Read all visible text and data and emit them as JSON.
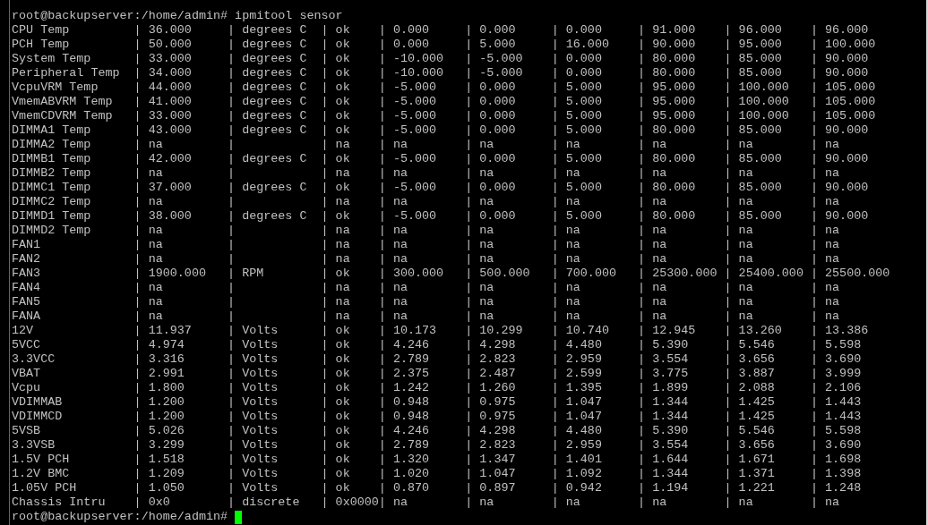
{
  "terminal": {
    "lines": [
      "root@backupserver:/home/admin# ipmitool sensor",
      "CPU Temp         | 36.000     | degrees C  | ok    | 0.000     | 0.000     | 0.000     | 91.000    | 96.000    | 96.000",
      "PCH Temp         | 50.000     | degrees C  | ok    | 0.000     | 5.000     | 16.000    | 90.000    | 95.000    | 100.000",
      "System Temp      | 33.000     | degrees C  | ok    | -10.000   | -5.000    | 0.000     | 80.000    | 85.000    | 90.000",
      "Peripheral Temp  | 34.000     | degrees C  | ok    | -10.000   | -5.000    | 0.000     | 80.000    | 85.000    | 90.000",
      "VcpuVRM Temp     | 44.000     | degrees C  | ok    | -5.000    | 0.000     | 5.000     | 95.000    | 100.000   | 105.000",
      "VmemABVRM Temp   | 41.000     | degrees C  | ok    | -5.000    | 0.000     | 5.000     | 95.000    | 100.000   | 105.000",
      "VmemCDVRM Temp   | 33.000     | degrees C  | ok    | -5.000    | 0.000     | 5.000     | 95.000    | 100.000   | 105.000",
      "DIMMA1 Temp      | 43.000     | degrees C  | ok    | -5.000    | 0.000     | 5.000     | 80.000    | 85.000    | 90.000",
      "DIMMA2 Temp      | na         |            | na    | na        | na        | na        | na        | na        | na",
      "DIMMB1 Temp      | 42.000     | degrees C  | ok    | -5.000    | 0.000     | 5.000     | 80.000    | 85.000    | 90.000",
      "DIMMB2 Temp      | na         |            | na    | na        | na        | na        | na        | na        | na",
      "DIMMC1 Temp      | 37.000     | degrees C  | ok    | -5.000    | 0.000     | 5.000     | 80.000    | 85.000    | 90.000",
      "DIMMC2 Temp      | na         |            | na    | na        | na        | na        | na        | na        | na",
      "DIMMD1 Temp      | 38.000     | degrees C  | ok    | -5.000    | 0.000     | 5.000     | 80.000    | 85.000    | 90.000",
      "DIMMD2 Temp      | na         |            | na    | na        | na        | na        | na        | na        | na",
      "FAN1             | na         |            | na    | na        | na        | na        | na        | na        | na",
      "FAN2             | na         |            | na    | na        | na        | na        | na        | na        | na",
      "FAN3             | 1900.000   | RPM        | ok    | 300.000   | 500.000   | 700.000   | 25300.000 | 25400.000 | 25500.000",
      "FAN4             | na         |            | na    | na        | na        | na        | na        | na        | na",
      "FAN5             | na         |            | na    | na        | na        | na        | na        | na        | na",
      "FANA             | na         |            | na    | na        | na        | na        | na        | na        | na",
      "12V              | 11.937     | Volts      | ok    | 10.173    | 10.299    | 10.740    | 12.945    | 13.260    | 13.386",
      "5VCC             | 4.974      | Volts      | ok    | 4.246     | 4.298     | 4.480     | 5.390     | 5.546     | 5.598",
      "3.3VCC           | 3.316      | Volts      | ok    | 2.789     | 2.823     | 2.959     | 3.554     | 3.656     | 3.690",
      "VBAT             | 2.991      | Volts      | ok    | 2.375     | 2.487     | 2.599     | 3.775     | 3.887     | 3.999",
      "Vcpu             | 1.800      | Volts      | ok    | 1.242     | 1.260     | 1.395     | 1.899     | 2.088     | 2.106",
      "VDIMMAB          | 1.200      | Volts      | ok    | 0.948     | 0.975     | 1.047     | 1.344     | 1.425     | 1.443",
      "VDIMMCD          | 1.200      | Volts      | ok    | 0.948     | 0.975     | 1.047     | 1.344     | 1.425     | 1.443",
      "5VSB             | 5.026      | Volts      | ok    | 4.246     | 4.298     | 4.480     | 5.390     | 5.546     | 5.598",
      "3.3VSB           | 3.299      | Volts      | ok    | 2.789     | 2.823     | 2.959     | 3.554     | 3.656     | 3.690",
      "1.5V PCH         | 1.518      | Volts      | ok    | 1.320     | 1.347     | 1.401     | 1.644     | 1.671     | 1.698",
      "1.2V BMC         | 1.209      | Volts      | ok    | 1.020     | 1.047     | 1.092     | 1.344     | 1.371     | 1.398",
      "1.05V PCH        | 1.050      | Volts      | ok    | 0.870     | 0.897     | 0.942     | 1.194     | 1.221     | 1.248",
      "Chassis Intru    | 0x0        | discrete   | 0x0000| na        | na        | na        | na        | na        | na"
    ],
    "prompt": "root@backupserver:/home/admin#"
  }
}
